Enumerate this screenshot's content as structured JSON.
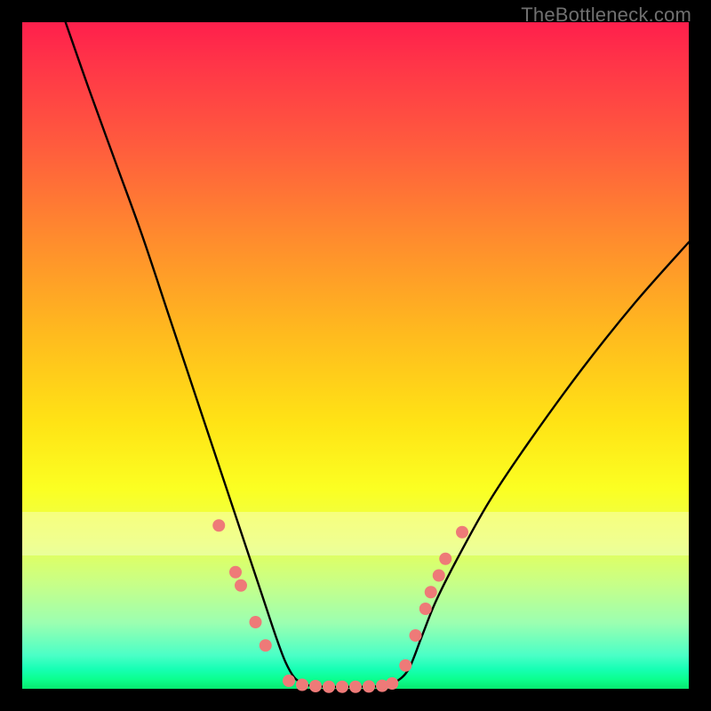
{
  "watermark": "TheBottleneck.com",
  "chart_data": {
    "type": "line",
    "title": "",
    "xlabel": "",
    "ylabel": "",
    "xlim": [
      0,
      100
    ],
    "ylim": [
      0,
      100
    ],
    "series": [
      {
        "name": "bottleneck-curve",
        "x": [
          6.5,
          10,
          14,
          18,
          22,
          25,
          28,
          30,
          32,
          34,
          36,
          38,
          39.5,
          41,
          43,
          46,
          50,
          54,
          56,
          58,
          60,
          62,
          65,
          70,
          76,
          84,
          92,
          100
        ],
        "y": [
          100,
          90,
          79,
          68,
          56,
          47,
          38,
          32,
          26,
          20,
          14,
          8,
          4,
          1.5,
          0.5,
          0.3,
          0.3,
          0.4,
          1.0,
          3,
          8,
          13,
          19,
          28,
          37,
          48,
          58,
          67
        ]
      }
    ],
    "markers": {
      "name": "scatter-points",
      "color": "#ee7a78",
      "points": [
        {
          "x": 29.5,
          "y": 24.5
        },
        {
          "x": 32.0,
          "y": 17.5
        },
        {
          "x": 32.8,
          "y": 15.5
        },
        {
          "x": 35.0,
          "y": 10.0
        },
        {
          "x": 36.5,
          "y": 6.5
        },
        {
          "x": 40.0,
          "y": 1.2
        },
        {
          "x": 42.0,
          "y": 0.6
        },
        {
          "x": 44.0,
          "y": 0.4
        },
        {
          "x": 46.0,
          "y": 0.3
        },
        {
          "x": 48.0,
          "y": 0.3
        },
        {
          "x": 50.0,
          "y": 0.3
        },
        {
          "x": 52.0,
          "y": 0.35
        },
        {
          "x": 54.0,
          "y": 0.45
        },
        {
          "x": 55.5,
          "y": 0.8
        },
        {
          "x": 57.5,
          "y": 3.5
        },
        {
          "x": 59.0,
          "y": 8.0
        },
        {
          "x": 60.5,
          "y": 12.0
        },
        {
          "x": 61.3,
          "y": 14.5
        },
        {
          "x": 62.5,
          "y": 17.0
        },
        {
          "x": 63.5,
          "y": 19.5
        },
        {
          "x": 66.0,
          "y": 23.5
        }
      ]
    },
    "background_gradient": {
      "top": "#ff1f4c",
      "mid": "#ffe315",
      "bottom": "#08e86e"
    }
  }
}
